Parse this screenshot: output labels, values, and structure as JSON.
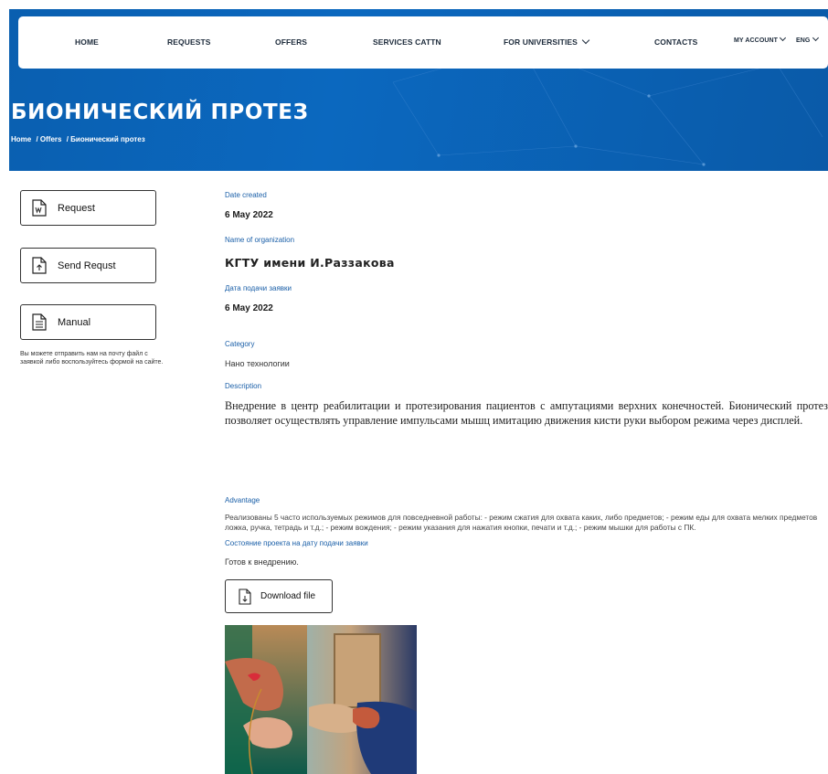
{
  "nav": {
    "home": "HOME",
    "requests": "REQUESTS",
    "offers": "OFFERS",
    "services": "SERVICES CATTN",
    "universities": "FOR UNIVERSITIES",
    "contacts": "CONTACTS",
    "account": "MY ACCOUNT",
    "language": "ENG"
  },
  "hero": {
    "title": "БИОНИЧЕСКИЙ ПРОТЕЗ",
    "breadcrumb": [
      "Home",
      "/ Offers",
      "/ Бионический протез"
    ]
  },
  "sidebar": {
    "request_label": "Request",
    "send_label": "Send Requst",
    "manual_label": "Manual",
    "note": "Вы можете отправить нам на почту файл с заявкой либо воспользуйтесь формой на сайте."
  },
  "details": {
    "date_created_label": "Date created",
    "date_created": "6 May 2022",
    "organization_label": "Name of organization",
    "organization": "КГТУ имени И.Раззакова",
    "submit_date_label": "Дата подачи заявки",
    "submit_date": "6 May 2022",
    "category_label": "Category",
    "category": "Нано технологии",
    "description_label": "Description",
    "description": "Внедрение в центр реабилитации и протезирования пациентов с ампутациями верхних конечностей. Бионический протез позволяет осуществлять управление импульсами мышц имитацию движения кисти руки выбором режима через дисплей.",
    "advantage_label": "Advantage",
    "advantage": "Реализованы 5 часто используемых режимов для повседневной работы: - режим сжатия для охвата каких, либо предметов; - режим еды для охвата мелких предметов ложка, ручка, тетрадь и т.д.; - режим вождения; - режим указания для нажатия кнопки, печати и т.д.; - режим мышки для работы с ПК.",
    "status_label": "Состояние проекта на дату подачи заявки",
    "status": "Готов к внедрению.",
    "download_label": "Download file"
  },
  "colors": {
    "brand_blue": "#0b63b6",
    "label_blue": "#1a5fa8"
  }
}
